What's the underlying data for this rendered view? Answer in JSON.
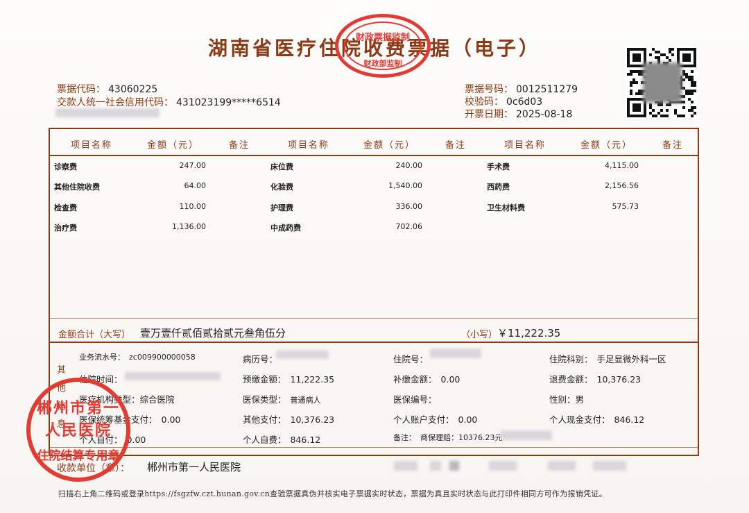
{
  "title": "湖南省医疗住院收费票据（电子）",
  "stamp_top": {
    "line1": "财政票据监制",
    "line2": "财政部监制"
  },
  "header": {
    "bill_code_label": "票据代码：",
    "bill_code": "43060225",
    "payer_id_label": "交款人统一社会信用代码：",
    "payer_id": "431023199*****6514",
    "bill_no_label": "票据号码：",
    "bill_no": "0012511279",
    "check_code_label": "校验码：",
    "check_code": "0c6d03",
    "issue_date_label": "开票日期：",
    "issue_date": "2025-08-18"
  },
  "table": {
    "columns": [
      "项目名称",
      "金额（元）",
      "备注",
      "项目名称",
      "金额（元）",
      "备注",
      "项目名称",
      "金额（元）",
      "备注"
    ],
    "col1": [
      {
        "name": "诊察费",
        "amount": "247.00"
      },
      {
        "name": "其他住院收费",
        "amount": "64.00"
      },
      {
        "name": "检查费",
        "amount": "110.00"
      },
      {
        "name": "治疗费",
        "amount": "1,136.00"
      }
    ],
    "col2": [
      {
        "name": "床位费",
        "amount": "240.00"
      },
      {
        "name": "化验费",
        "amount": "1,540.00"
      },
      {
        "name": "护理费",
        "amount": "336.00"
      },
      {
        "name": "中成药费",
        "amount": "702.06"
      }
    ],
    "col3": [
      {
        "name": "手术费",
        "amount": "4,115.00"
      },
      {
        "name": "西药费",
        "amount": "2,156.56"
      },
      {
        "name": "卫生材料费",
        "amount": "575.73"
      }
    ]
  },
  "total": {
    "label": "金额合计（大写）",
    "value_cn": "壹万壹仟贰佰贰拾贰元叁角伍分",
    "small_label": "（小写）",
    "value_num": "￥11,222.35"
  },
  "other": {
    "label": "其他信息",
    "serial_label": "业务流水号：",
    "serial": "zc009900000058",
    "record_label": "病历号：",
    "inpatient_no_label": "住院号：",
    "dept_label": "住院科别：",
    "dept": "手足显微外科一区",
    "time_label": "住院时间：",
    "prepay_label": "预缴金额：",
    "prepay": "11,222.35",
    "supplement_label": "补缴金额：",
    "supplement": "0.00",
    "refund_label": "退费金额：",
    "refund": "10,376.23",
    "inst_type_label": "医疗机构类型：",
    "inst_type": "综合医院",
    "ins_type_label": "医保类型：",
    "ins_type": "普通病人",
    "ins_no_label": "医保编号：",
    "gender_label": "性别：",
    "gender": "男",
    "fund_label": "医保统筹基金支付：",
    "fund": "0.00",
    "other_pay_label": "其他支付：",
    "other_pay": "10,376.23",
    "acct_pay_label": "个人账户支付：",
    "acct_pay": "0.00",
    "cash_pay_label": "个人现金支付：",
    "cash_pay": "846.12",
    "self_pay_label": "个人自付：",
    "self_pay": "0.00",
    "self_expense_label": "个人自费：",
    "self_expense": "846.12",
    "note_label": "备注：",
    "note": "商保理赔：10376.23元"
  },
  "payee": {
    "label": "收款单位（章）：",
    "value": "郴州市第一人民医院"
  },
  "stamp_bottom": {
    "arc": "郴州市第一人民医院",
    "bar": "住院结算专用章"
  },
  "footer": "扫描右上角二维码或登录https://fsgzfw.czt.hunan.gov.cn查验票据真伪并核实电子票据实时状态，票据为真且实时状态与此打印件相同方可作为报销凭证。"
}
